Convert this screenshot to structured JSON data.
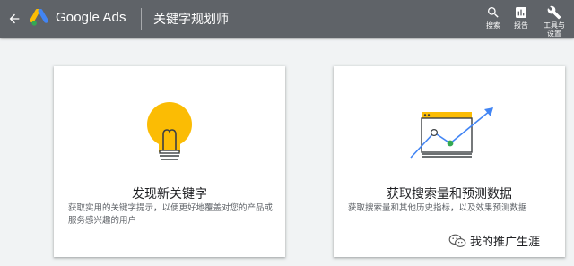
{
  "header": {
    "app_name": "Google Ads",
    "tool_title": "关键字规划师",
    "actions": [
      {
        "icon": "search-icon",
        "label": "搜索"
      },
      {
        "icon": "reports-icon",
        "label": "报告"
      },
      {
        "icon": "wrench-icon",
        "label_line1": "工具与",
        "label_line2": "设置"
      }
    ]
  },
  "cards": [
    {
      "title": "发现新关键字",
      "description": "获取实用的关键字提示，以便更好地覆盖对您的产品或服务感兴趣的用户",
      "illustration": "lightbulb"
    },
    {
      "title": "获取搜索量和预测数据",
      "description": "获取搜索量和其他历史指标，以及效果预测数据",
      "illustration": "chart-window"
    }
  ],
  "watermark": {
    "text": "我的推广生涯"
  },
  "colors": {
    "topbar": "#5f6368",
    "background": "#f1f3f4",
    "bulb": "#fbbc04",
    "chart_line": "#4285f4",
    "chart_point": "#34a853"
  }
}
